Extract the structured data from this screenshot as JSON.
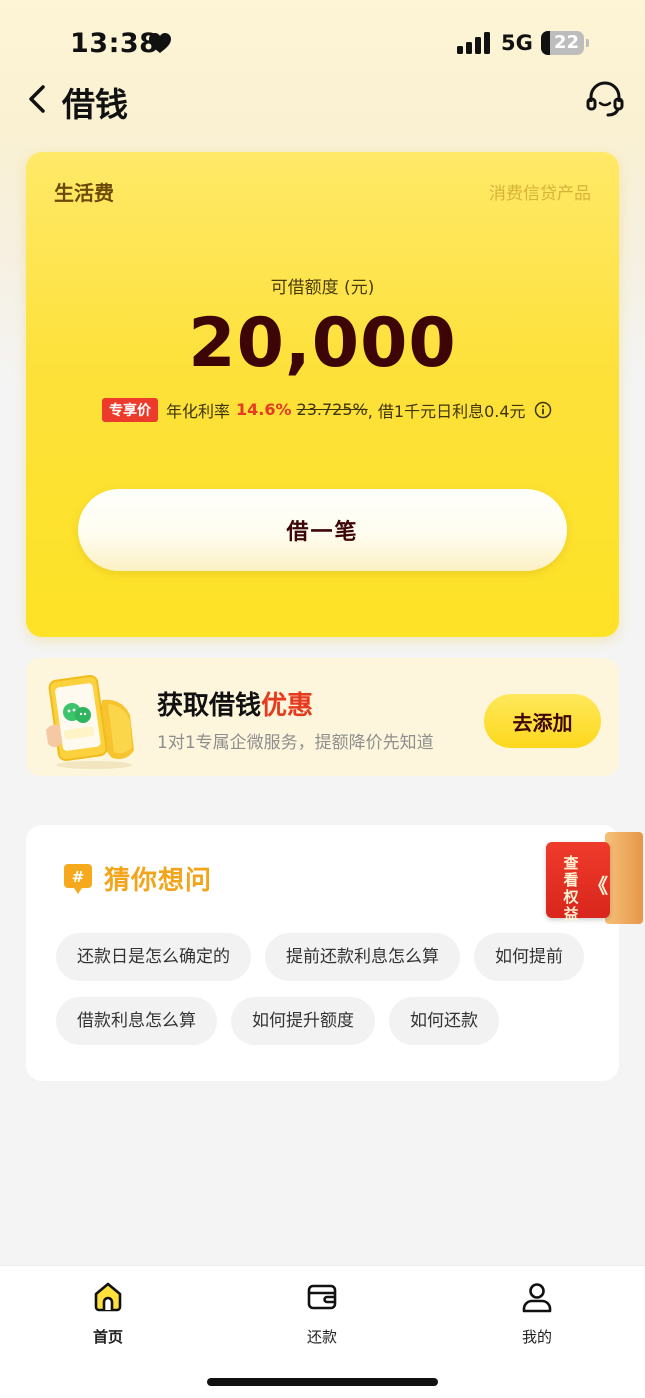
{
  "status_bar": {
    "time": "13:38",
    "network": "5G",
    "battery": "22",
    "battery_level": 0.22
  },
  "nav": {
    "title": "借钱"
  },
  "main_card": {
    "tag": "生活费",
    "product_type": "消费信贷产品",
    "limit_label": "可借额度 (元)",
    "limit_value": "20,000",
    "rate_badge": "专享价",
    "rate_label": "年化利率",
    "rate_value": "14.6%",
    "rate_old": "23.725%",
    "rate_note": ", 借1千元日利息0.4元",
    "borrow_button": "借一笔"
  },
  "promo": {
    "title_prefix": "获取借钱",
    "title_highlight": "优惠",
    "subtitle": "1对1专属企微服务，提额降价先知道",
    "button": "去添加",
    "phone_label": "借钱管家"
  },
  "faq": {
    "title": "猜你想问",
    "row1": [
      "还款日是怎么确定的",
      "提前还款利息怎么算",
      "如何提前"
    ],
    "row2": [
      "借款利息怎么算",
      "如何提升额度",
      "如何还款"
    ]
  },
  "benefits_tab": {
    "label": "查看权益",
    "arrow": "《"
  },
  "tab_bar": {
    "items": [
      {
        "label": "首页",
        "icon": "home-icon",
        "active": true
      },
      {
        "label": "还款",
        "icon": "wallet-icon",
        "active": false
      },
      {
        "label": "我的",
        "icon": "person-icon",
        "active": false
      }
    ]
  },
  "colors": {
    "accent_yellow": "#fde13a",
    "highlight_red": "#e63a1e",
    "faq_orange": "#f2a51a"
  }
}
